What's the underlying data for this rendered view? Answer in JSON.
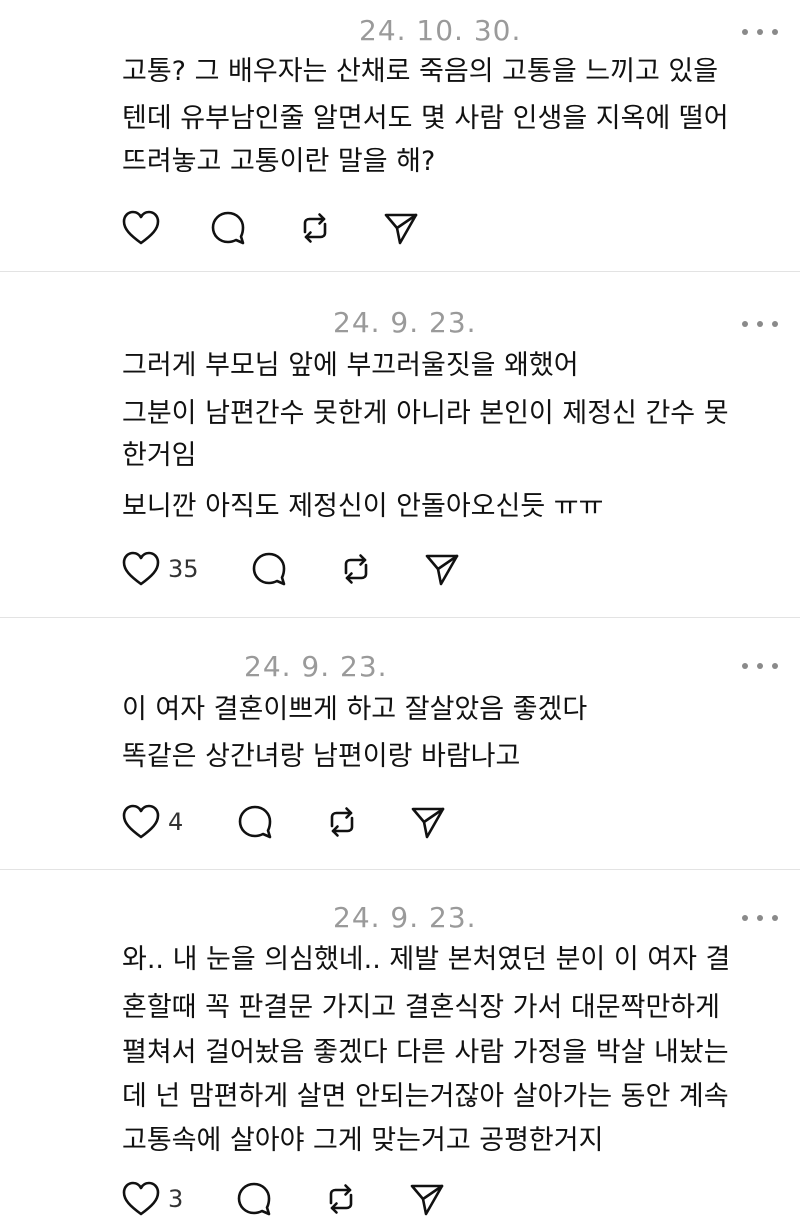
{
  "posts": [
    {
      "date": "24. 10. 30.",
      "lines": [
        "고통? 그 배우자는 산채로 죽음의 고통을 느끼고 있을",
        "텐데 유부남인줄 알면서도 몇 사람 인생을 지옥에 떨어",
        "뜨려놓고 고통이란 말을 해?"
      ],
      "like_count": ""
    },
    {
      "date": "24. 9. 23.",
      "lines": [
        "그러게 부모님 앞에 부끄러울짓을 왜했어",
        "그분이 남편간수 못한게 아니라 본인이 제정신 간수 못",
        "한거임",
        "보니깐 아직도 제정신이 안돌아오신듯 ㅠㅠ"
      ],
      "like_count": "35"
    },
    {
      "date": "24. 9. 23.",
      "lines": [
        "이 여자 결혼이쁘게 하고 잘살았음 좋겠다",
        "똑같은 상간녀랑 남편이랑 바람나고"
      ],
      "like_count": "4"
    },
    {
      "date": "24. 9. 23.",
      "lines": [
        "와.. 내 눈을 의심했네.. 제발 본처였던 분이 이 여자 결",
        "혼할때 꼭 판결문 가지고 결혼식장 가서 대문짝만하게",
        "펼쳐서 걸어놨음 좋겠다 다른 사람 가정을 박살 내놨는",
        "데 넌 맘편하게 살면 안되는거잖아 살아가는 동안 계속",
        "고통속에 살아야 그게 맞는거고 공평한거지"
      ],
      "like_count": "3"
    }
  ],
  "icons": {
    "like": "heart-icon",
    "reply": "comment-bubble-icon",
    "repost": "repost-icon",
    "share": "send-icon",
    "more": "more-dots-icon"
  },
  "colors": {
    "text": "#111111",
    "date": "#9a9a9a",
    "icon": "#111111",
    "divider": "#e3e3e3"
  }
}
